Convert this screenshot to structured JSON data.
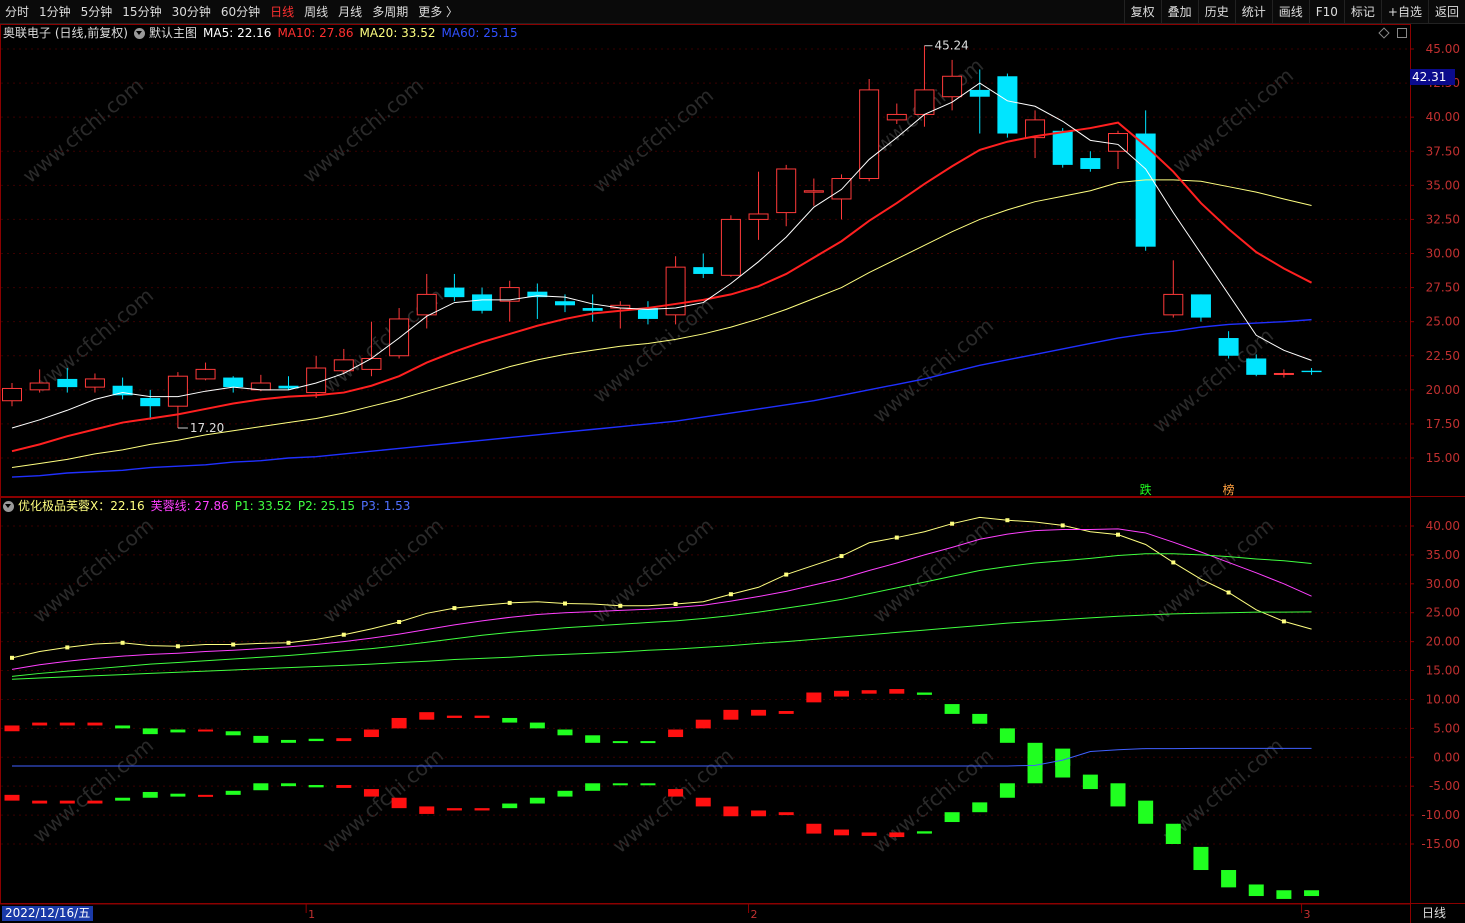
{
  "toolbar": {
    "periods": [
      "分时",
      "1分钟",
      "5分钟",
      "15分钟",
      "30分钟",
      "60分钟",
      "日线",
      "周线",
      "月线",
      "多周期",
      "更多 〉"
    ],
    "active_period": "日线",
    "right_buttons": [
      "复权",
      "叠加",
      "历史",
      "统计",
      "画线",
      "F10",
      "标记",
      "+自选",
      "返回"
    ]
  },
  "header": {
    "stock": "奥联电子 (日线,前复权)",
    "template": "默认主图",
    "ma5": "MA5: 22.16",
    "ma10": "MA10: 27.86",
    "ma20": "MA20: 33.52",
    "ma60": "MA60: 25.15"
  },
  "indicator_header": {
    "name": "优化极品芙蓉X：22.16",
    "line": "芙蓉线: 27.86",
    "p1": "P1: 33.52",
    "p2": "P2: 25.15",
    "p3": "P3: 1.53"
  },
  "current_price": "42.31",
  "date_label": "2022/12/16/五",
  "period_label": "日线",
  "watermark": "www.cfchi.com",
  "colors": {
    "up": "#ff3a3a",
    "down": "#00e5ff",
    "ma5": "#ffffff",
    "ma10": "#ff2020",
    "ma20": "#ffff80",
    "ma60": "#2030ff",
    "ind_yellow": "#ffff80",
    "ind_magenta": "#ff40ff",
    "ind_green": "#40ff40",
    "ind_blue": "#4060ff",
    "bar_red": "#ff1010",
    "bar_green": "#20ff20",
    "frame": "#8b0000"
  },
  "chart_data": [
    {
      "type": "candlestick",
      "ylim": [
        12.5,
        46.5
      ],
      "y_ticks": [
        "45.00",
        "42.50",
        "40.00",
        "37.50",
        "35.00",
        "32.50",
        "30.00",
        "27.50",
        "25.00",
        "22.50",
        "20.00",
        "17.50",
        "15.00"
      ],
      "y_values": [
        45,
        42.5,
        40,
        37.5,
        35,
        32.5,
        30,
        27.5,
        25,
        22.5,
        20,
        17.5,
        15
      ],
      "annotations": [
        {
          "text": "45.24",
          "index": 33,
          "value": 45.24
        },
        {
          "text": "17.20",
          "index": 6,
          "value": 17.2
        }
      ],
      "markers": [
        {
          "text": "跌",
          "index": 41
        },
        {
          "text": "榜",
          "index": 44
        }
      ],
      "month_labels": [
        {
          "text": "1",
          "index": 11
        },
        {
          "text": "2",
          "index": 27
        },
        {
          "text": "3",
          "index": 47
        }
      ],
      "candles": [
        [
          19.2,
          20.5,
          18.8,
          20.1
        ],
        [
          20.0,
          21.5,
          19.8,
          20.5
        ],
        [
          20.8,
          21.6,
          19.8,
          20.2
        ],
        [
          20.2,
          21.2,
          19.8,
          20.8
        ],
        [
          20.3,
          20.9,
          19.3,
          19.6
        ],
        [
          19.4,
          20.0,
          17.8,
          18.8
        ],
        [
          18.8,
          21.3,
          17.2,
          21.0
        ],
        [
          20.8,
          22.0,
          20.7,
          21.5
        ],
        [
          20.9,
          21.0,
          19.8,
          20.2
        ],
        [
          20.0,
          21.1,
          19.9,
          20.5
        ],
        [
          20.3,
          21.0,
          20.0,
          20.1
        ],
        [
          19.8,
          22.5,
          19.4,
          21.6
        ],
        [
          21.4,
          23.0,
          21.2,
          22.2
        ],
        [
          21.5,
          25.0,
          21.0,
          22.3
        ],
        [
          22.5,
          26.0,
          22.3,
          25.2
        ],
        [
          25.5,
          28.5,
          24.5,
          27.0
        ],
        [
          27.5,
          28.5,
          26.5,
          26.8
        ],
        [
          27.0,
          27.5,
          25.6,
          25.8
        ],
        [
          26.5,
          28.0,
          25.0,
          27.5
        ],
        [
          27.2,
          27.8,
          25.2,
          26.8
        ],
        [
          26.5,
          27.0,
          25.7,
          26.2
        ],
        [
          26.0,
          27.0,
          25.0,
          25.8
        ],
        [
          26.0,
          26.5,
          24.5,
          26.2
        ],
        [
          26.0,
          26.5,
          24.8,
          25.2
        ],
        [
          25.5,
          29.8,
          24.8,
          29.0
        ],
        [
          29.0,
          30.0,
          28.2,
          28.5
        ],
        [
          28.4,
          32.8,
          28.3,
          32.5
        ],
        [
          32.5,
          36.0,
          31.0,
          32.9
        ],
        [
          33.0,
          36.5,
          32.0,
          36.2
        ],
        [
          34.5,
          35.5,
          33.5,
          34.6
        ],
        [
          34.0,
          35.8,
          32.5,
          35.5
        ],
        [
          35.5,
          42.8,
          35.3,
          42.0
        ],
        [
          39.8,
          41.0,
          39.5,
          40.2
        ],
        [
          40.2,
          45.24,
          39.3,
          42.0
        ],
        [
          41.5,
          44.2,
          40.5,
          43.0
        ],
        [
          42.0,
          43.5,
          38.8,
          41.5
        ],
        [
          43.0,
          43.2,
          38.5,
          38.8
        ],
        [
          38.5,
          40.5,
          37.0,
          39.8
        ],
        [
          39.0,
          39.2,
          36.3,
          36.5
        ],
        [
          37.0,
          37.5,
          36.0,
          36.2
        ],
        [
          37.5,
          39.0,
          36.2,
          38.8
        ],
        [
          38.8,
          40.5,
          30.2,
          30.5
        ],
        [
          25.5,
          29.5,
          25.3,
          27.0
        ],
        [
          27.0,
          27.0,
          25.0,
          25.3
        ],
        [
          23.8,
          24.3,
          22.3,
          22.5
        ],
        [
          22.3,
          22.6,
          21.0,
          21.1
        ],
        [
          21.2,
          21.5,
          20.9,
          21.2
        ],
        [
          21.4,
          21.6,
          21.1,
          21.3
        ]
      ]
    },
    {
      "type": "line+bar",
      "ylim": [
        -25,
        45
      ],
      "y_ticks": [
        "40.00",
        "35.00",
        "30.00",
        "25.00",
        "20.00",
        "15.00",
        "10.00",
        "5.00",
        "0.00",
        "-5.00",
        "-10.00",
        "-15.00"
      ],
      "y_values": [
        40,
        35,
        30,
        25,
        20,
        15,
        10,
        5,
        0,
        -5,
        -10,
        -15
      ],
      "series": [
        {
          "name": "优化极品芙蓉X",
          "values": [
            17.2,
            18.3,
            19.0,
            19.6,
            19.8,
            19.3,
            19.2,
            19.5,
            19.5,
            19.7,
            19.8,
            20.4,
            21.2,
            22.2,
            23.4,
            24.9,
            25.8,
            26.3,
            26.7,
            26.9,
            26.6,
            26.5,
            26.2,
            26.2,
            26.5,
            26.9,
            28.2,
            29.4,
            31.6,
            33.2,
            34.8,
            37.1,
            38.0,
            39.0,
            40.4,
            41.5,
            41.0,
            40.7,
            40.1,
            39.0,
            38.5,
            36.8,
            33.7,
            30.8,
            28.5,
            25.5,
            23.5,
            22.16
          ]
        },
        {
          "name": "芙蓉线",
          "values": [
            15.2,
            16.0,
            16.6,
            17.1,
            17.5,
            17.8,
            18.0,
            18.3,
            18.5,
            18.8,
            19.1,
            19.5,
            20.0,
            20.6,
            21.3,
            22.1,
            22.9,
            23.6,
            24.2,
            24.7,
            25.0,
            25.2,
            25.4,
            25.6,
            25.9,
            26.3,
            27.0,
            27.8,
            28.7,
            29.8,
            30.9,
            32.3,
            33.6,
            35.0,
            36.3,
            37.7,
            38.6,
            39.2,
            39.4,
            39.4,
            39.5,
            38.8,
            37.2,
            35.5,
            33.7,
            31.9,
            30.0,
            27.86
          ]
        },
        {
          "name": "P1",
          "values": [
            14.0,
            14.5,
            14.9,
            15.3,
            15.7,
            16.1,
            16.4,
            16.7,
            17.0,
            17.3,
            17.6,
            18.0,
            18.4,
            18.8,
            19.3,
            19.9,
            20.5,
            21.1,
            21.6,
            22.0,
            22.4,
            22.7,
            23.0,
            23.3,
            23.6,
            24.0,
            24.5,
            25.1,
            25.8,
            26.5,
            27.3,
            28.3,
            29.3,
            30.3,
            31.3,
            32.3,
            33.0,
            33.6,
            34.0,
            34.4,
            34.9,
            35.2,
            35.2,
            35.0,
            34.7,
            34.3,
            34.0,
            33.52
          ]
        },
        {
          "name": "P2",
          "values": [
            13.5,
            13.7,
            13.9,
            14.1,
            14.3,
            14.5,
            14.7,
            14.9,
            15.1,
            15.3,
            15.5,
            15.7,
            15.9,
            16.1,
            16.4,
            16.6,
            16.9,
            17.1,
            17.3,
            17.6,
            17.8,
            18.0,
            18.2,
            18.5,
            18.7,
            19.0,
            19.3,
            19.7,
            20.0,
            20.4,
            20.8,
            21.2,
            21.6,
            22.0,
            22.4,
            22.8,
            23.2,
            23.5,
            23.8,
            24.1,
            24.4,
            24.6,
            24.8,
            24.9,
            25.0,
            25.1,
            25.1,
            25.15
          ]
        },
        {
          "name": "P3",
          "values": [
            -1.5,
            -1.5,
            -1.5,
            -1.5,
            -1.5,
            -1.5,
            -1.5,
            -1.5,
            -1.5,
            -1.5,
            -1.5,
            -1.5,
            -1.5,
            -1.5,
            -1.5,
            -1.5,
            -1.5,
            -1.5,
            -1.5,
            -1.5,
            -1.5,
            -1.5,
            -1.5,
            -1.5,
            -1.5,
            -1.5,
            -1.5,
            -1.5,
            -1.5,
            -1.5,
            -1.5,
            -1.5,
            -1.5,
            -1.5,
            -1.5,
            -1.5,
            -1.5,
            -1.4,
            -0.5,
            1.0,
            1.3,
            1.5,
            1.5,
            1.53,
            1.53,
            1.53,
            1.53,
            1.53
          ]
        }
      ],
      "bars": [
        [
          4.5,
          5.5,
          "r"
        ],
        [
          5.5,
          6.0,
          "r"
        ],
        [
          5.5,
          6.0,
          "r"
        ],
        [
          5.5,
          6.0,
          "r"
        ],
        [
          5.0,
          5.5,
          "g"
        ],
        [
          4.0,
          5.0,
          "g"
        ],
        [
          4.3,
          4.8,
          "g"
        ],
        [
          4.5,
          4.8,
          "r"
        ],
        [
          3.8,
          4.5,
          "g"
        ],
        [
          2.5,
          3.7,
          "g"
        ],
        [
          2.5,
          3.0,
          "g"
        ],
        [
          2.8,
          3.2,
          "g"
        ],
        [
          2.8,
          3.3,
          "r"
        ],
        [
          3.5,
          4.8,
          "r"
        ],
        [
          5.0,
          6.8,
          "r"
        ],
        [
          6.5,
          7.8,
          "r"
        ],
        [
          6.8,
          7.2,
          "r"
        ],
        [
          6.8,
          7.2,
          "r"
        ],
        [
          6.0,
          6.8,
          "g"
        ],
        [
          5.0,
          6.0,
          "g"
        ],
        [
          3.8,
          4.8,
          "g"
        ],
        [
          2.5,
          3.8,
          "g"
        ],
        [
          2.5,
          2.8,
          "g"
        ],
        [
          2.5,
          2.8,
          "g"
        ],
        [
          3.5,
          4.8,
          "r"
        ],
        [
          5.0,
          6.5,
          "r"
        ],
        [
          6.5,
          8.2,
          "r"
        ],
        [
          7.2,
          8.2,
          "r"
        ],
        [
          7.5,
          8.0,
          "r"
        ],
        [
          9.5,
          11.2,
          "r"
        ],
        [
          10.5,
          11.5,
          "r"
        ],
        [
          11.0,
          11.6,
          "r"
        ],
        [
          11.0,
          11.8,
          "r"
        ],
        [
          10.8,
          11.2,
          "g"
        ],
        [
          7.5,
          9.2,
          "g"
        ],
        [
          5.8,
          7.5,
          "g"
        ],
        [
          2.5,
          5.0,
          "g"
        ],
        [
          -2.5,
          2.5,
          "g"
        ],
        [
          -1.5,
          1.5,
          "g"
        ],
        [
          -5.5,
          -3.0,
          "g"
        ],
        [
          -8.5,
          -4.5,
          "g"
        ],
        [
          -11.5,
          -7.5,
          "g"
        ],
        [
          -15.0,
          -11.5,
          "g"
        ],
        [
          -19.5,
          -15.5,
          "g"
        ],
        [
          -22.5,
          -19.5,
          "g"
        ],
        [
          -24.0,
          -22.0,
          "g"
        ],
        [
          -24.5,
          -23.0,
          "g"
        ],
        [
          -24.0,
          -23.0,
          "g"
        ]
      ]
    }
  ]
}
